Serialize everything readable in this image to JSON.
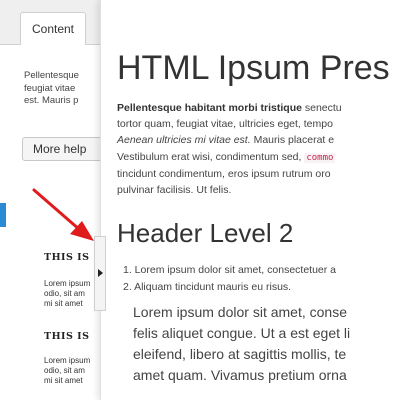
{
  "left_panel": {
    "tab_label": "Content",
    "paragraph_lines": [
      "Pellentesque",
      "feugiat vitae",
      "est. Mauris p"
    ],
    "more_help_label": "More help",
    "heading_1": "THIS IS",
    "lines_1": [
      "Lorem ipsum",
      "odio, sit am",
      "mi sit amet"
    ],
    "heading_2": "THIS IS",
    "lines_2": [
      "Lorem ipsum",
      "odio, sit am",
      "mi sit amet"
    ]
  },
  "preview": {
    "title": "HTML Ipsum Pres",
    "intro": {
      "line1_bold": "Pellentesque habitant morbi tristique",
      "line1_rest": " senectu",
      "line2": "tortor quam, feugiat vitae, ultricies eget, tempo",
      "line3_em": "Aenean ultricies mi vitae est.",
      "line3_rest": " Mauris placerat e",
      "line4_text": "Vestibulum erat wisi, condimentum sed, ",
      "line4_code": "commo",
      "line5": "tincidunt condimentum, eros ipsum rutrum oro",
      "line6": "pulvinar facilisis. Ut felis."
    },
    "header_2": "Header Level 2",
    "ordered_list": [
      "1. Lorem ipsum dolor sit amet, consectetuer a",
      "2. Aliquam tincidunt mauris eu risus."
    ],
    "blockquote_lines": [
      "Lorem ipsum dolor sit amet, conse",
      "felis aliquet congue. Ut a est eget li",
      "eleifend, libero at sagittis mollis, te",
      "amet quam. Vivamus pretium orna"
    ]
  },
  "colors": {
    "accent_blue": "#2a8ad4",
    "annotation_red": "#e01b1b",
    "code_pink": "#c7254e"
  },
  "icons": {
    "collapse_toggle": "triangle-right-icon",
    "annotation": "red-arrow-icon"
  }
}
